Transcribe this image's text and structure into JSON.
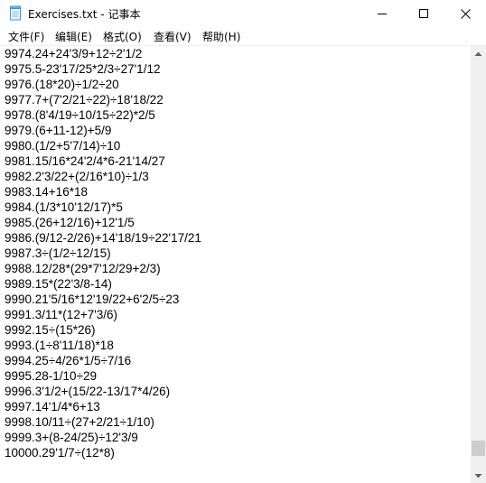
{
  "window": {
    "title": "Exercises.txt - 记事本"
  },
  "menu": {
    "file": "文件(F)",
    "edit": "编辑(E)",
    "format": "格式(O)",
    "view": "查看(V)",
    "help": "帮助(H)"
  },
  "lines": [
    "9974.24+24'3/9+12÷2'1/2",
    "9975.5-23'17/25*2/3÷27'1/12",
    "9976.(18*20)÷1/2÷20",
    "9977.7+(7'2/21÷22)÷18'18/22",
    "9978.(8'4/19÷10/15÷22)*2/5",
    "9979.(6+11-12)+5/9",
    "9980.(1/2+5'7/14)÷10",
    "9981.15/16*24'2/4*6-21'14/27",
    "9982.2'3/22+(2/16*10)÷1/3",
    "9983.14+16*18",
    "9984.(1/3*10'12/17)*5",
    "9985.(26+12/16)+12'1/5",
    "9986.(9/12-2/26)+14'18/19÷22'17/21",
    "9987.3÷(1/2÷12/15)",
    "9988.12/28*(29*7'12/29+2/3)",
    "9989.15*(22'3/8-14)",
    "9990.21'5/16*12'19/22+6'2/5÷23",
    "9991.3/11*(12+7'3/6)",
    "9992.15÷(15*26)",
    "9993.(1÷8'11/18)*18",
    "9994.25÷4/26*1/5÷7/16",
    "9995.28-1/10÷29",
    "9996.3'1/2+(15/22-13/17*4/26)",
    "9997.14'1/4*6+13",
    "9998.10/11÷(27+2/21÷1/10)",
    "9999.3+(8-24/25)÷12'3/9",
    "10000.29'1/7÷(12*8)"
  ],
  "scrollbar": {
    "position": 0.97
  }
}
